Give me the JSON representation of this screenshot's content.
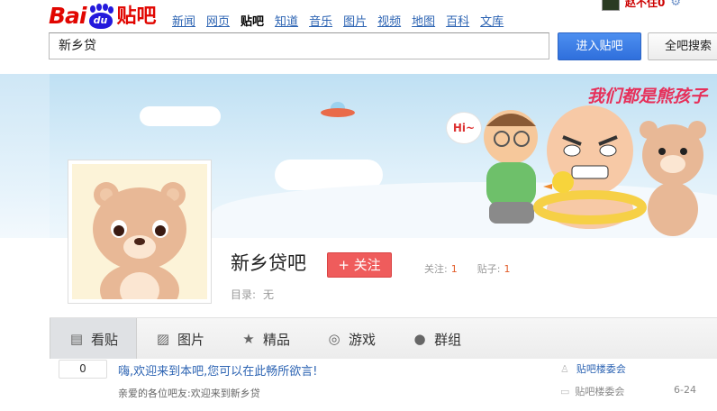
{
  "header": {
    "logo_left": "Bai",
    "logo_paw": "du",
    "logo_right": "贴吧",
    "nav": [
      {
        "label": "新闻",
        "active": false
      },
      {
        "label": "网页",
        "active": false
      },
      {
        "label": "贴吧",
        "active": true
      },
      {
        "label": "知道",
        "active": false
      },
      {
        "label": "音乐",
        "active": false
      },
      {
        "label": "图片",
        "active": false
      },
      {
        "label": "视频",
        "active": false
      },
      {
        "label": "地图",
        "active": false
      },
      {
        "label": "百科",
        "active": false
      },
      {
        "label": "文库",
        "active": false
      }
    ],
    "username": "赵不住0",
    "search_value": "新乡贷",
    "enter_button": "进入贴吧",
    "all_search_button": "全吧搜索"
  },
  "banner": {
    "slogan": "我们都是熊孩子",
    "hi_text": "Hi~"
  },
  "forum": {
    "name": "新乡贷吧",
    "follow_label": "+ 关注",
    "followers_label": "关注:",
    "followers_value": "1",
    "posts_label": "贴子:",
    "posts_value": "1",
    "catalog_label": "目录:",
    "catalog_value": "无"
  },
  "tabs": [
    {
      "label": "看贴",
      "icon": "document-icon",
      "active": true
    },
    {
      "label": "图片",
      "icon": "image-icon",
      "active": false
    },
    {
      "label": "精品",
      "icon": "star-icon",
      "active": false
    },
    {
      "label": "游戏",
      "icon": "gamepad-icon",
      "active": false
    },
    {
      "label": "群组",
      "icon": "chat-icon",
      "active": false
    }
  ],
  "threads": [
    {
      "reply_count": "0",
      "title": "嗨,欢迎来到本吧,您可以在此畅所欲言!",
      "abstract": "亲爱的各位吧友:欢迎来到新乡贷",
      "author": "贴吧楼委会",
      "last_replier": "贴吧楼委会",
      "last_time": "6-24"
    }
  ],
  "colors": {
    "brand_red": "#e10601",
    "brand_blue": "#2319dc",
    "link_blue": "#2d64b3",
    "follow_red": "#ef5c5c",
    "stat_orange": "#e25c28"
  }
}
